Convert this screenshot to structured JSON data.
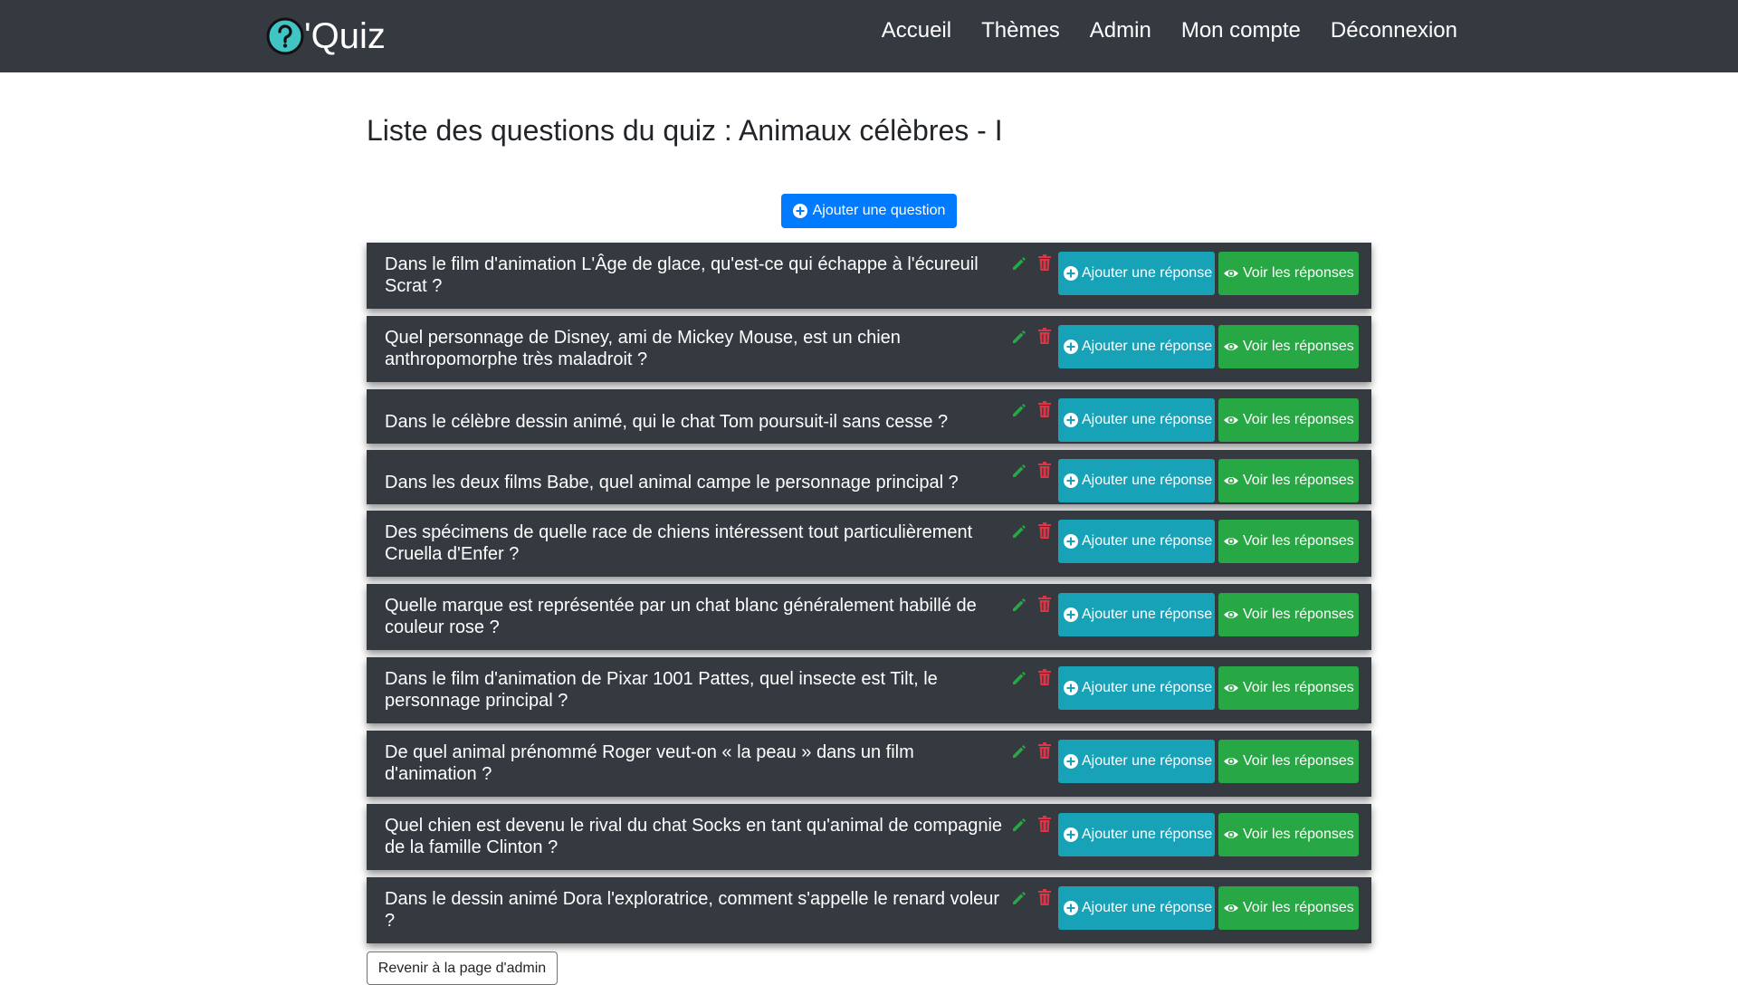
{
  "brand": {
    "text": "'Quiz",
    "logo_icon": "question-circle-icon",
    "logo_color": "#40c4c4"
  },
  "nav": {
    "items": [
      {
        "label": "Accueil"
      },
      {
        "label": "Thèmes"
      },
      {
        "label": "Admin"
      },
      {
        "label": "Mon compte"
      },
      {
        "label": "Déconnexion"
      }
    ]
  },
  "page": {
    "title": "Liste des questions du quiz : Animaux célèbres - I",
    "add_question_label": "Ajouter une question",
    "back_label": "Revenir à la page d'admin"
  },
  "question_actions": {
    "add_answer_label": "Ajouter une réponse",
    "see_answers_label": "Voir les réponses",
    "edit_icon": "pencil-icon",
    "delete_icon": "trash-icon"
  },
  "colors": {
    "navbar": "#343a40",
    "row_bg": "#343a40",
    "primary": "#007bff",
    "info": "#17a2b8",
    "success": "#28a745",
    "danger": "#dc3545",
    "edit_green": "#28a745"
  },
  "questions": [
    {
      "text": "Dans le film d'animation L'Âge de glace, qu'est-ce qui échappe à l'écureuil Scrat ?"
    },
    {
      "text": "Quel personnage de Disney, ami de Mickey Mouse, est un chien anthropomorphe très maladroit ?"
    },
    {
      "text": "Dans le célèbre dessin animé, qui le chat Tom poursuit-il sans cesse ?"
    },
    {
      "text": "Dans les deux films Babe, quel animal campe le personnage principal ?"
    },
    {
      "text": "Des spécimens de quelle race de chiens intéressent tout particulièrement Cruella d'Enfer ?"
    },
    {
      "text": "Quelle marque est représentée par un chat blanc généralement habillé de couleur rose ?"
    },
    {
      "text": "Dans le film d'animation de Pixar 1001 Pattes, quel insecte est Tilt, le personnage principal ?"
    },
    {
      "text": "De quel animal prénommé Roger veut-on « la peau » dans un film d'animation ?"
    },
    {
      "text": "Quel chien est devenu le rival du chat Socks en tant qu'animal de compagnie de la famille Clinton ?"
    },
    {
      "text": "Dans le dessin animé Dora l'exploratrice, comment s'appelle le renard voleur ?"
    }
  ]
}
